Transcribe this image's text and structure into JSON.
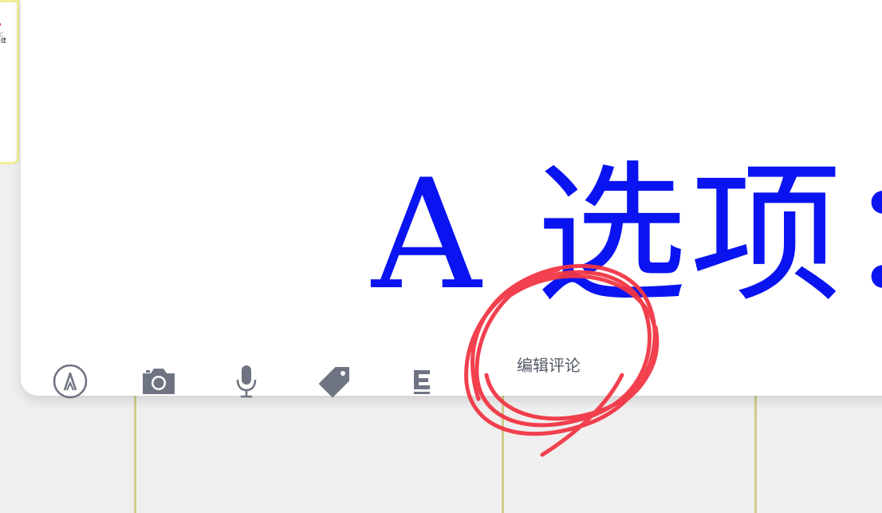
{
  "background": {
    "color": "#efefef",
    "grid_line_color": "#cfcd8a"
  },
  "thumbnail": {
    "text": "艳：\n十建"
  },
  "note": {
    "text": "A 选项：",
    "color": "#0a14f0"
  },
  "toolbar": {
    "icons": [
      "markup-pen-icon",
      "camera-icon",
      "microphone-icon",
      "tag-icon",
      "text-format-icon"
    ],
    "icon_color": "#6e7482",
    "edit_comment_label": "编辑评论"
  },
  "annotation": {
    "shape": "hand-drawn circle",
    "color": "#f23645"
  }
}
